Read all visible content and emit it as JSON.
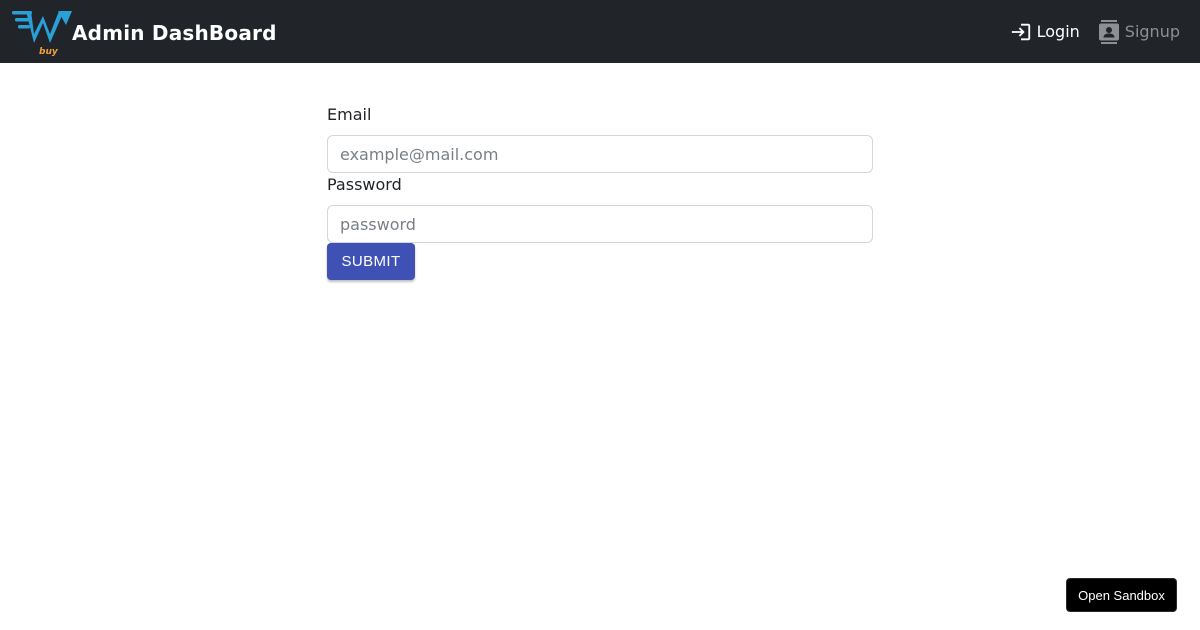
{
  "navbar": {
    "brand": {
      "logo_icon": "ewbuy-logo",
      "logo_subtext": "buy",
      "title": "Admin DashBoard"
    },
    "links": {
      "login": {
        "label": "Login",
        "icon": "login-icon"
      },
      "signup": {
        "label": "Signup",
        "icon": "contact-card-icon"
      }
    }
  },
  "form": {
    "email": {
      "label": "Email",
      "placeholder": "example@mail.com",
      "value": ""
    },
    "password": {
      "label": "Password",
      "placeholder": "password",
      "value": ""
    },
    "submit_label": "SUBMIT"
  },
  "sandbox": {
    "label": "Open Sandbox"
  },
  "colors": {
    "navbar_bg": "#212529",
    "submit_bg": "#3f51b5",
    "logo_blue": "#2a9fd8",
    "logo_orange": "#f2a03d",
    "signup_text": "#8c8f93"
  }
}
